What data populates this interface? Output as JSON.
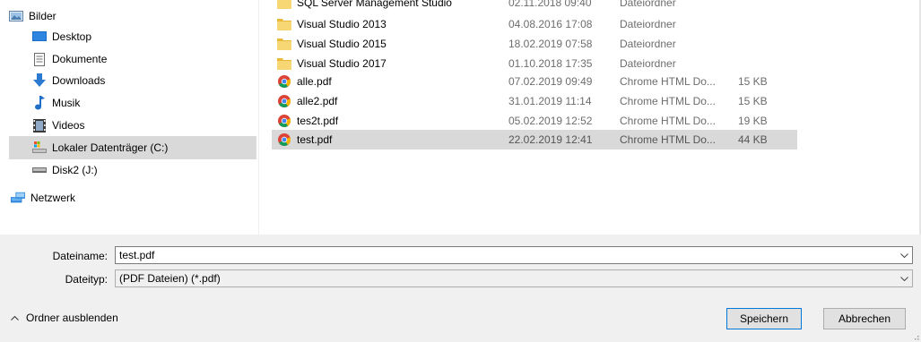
{
  "nav": {
    "items": [
      {
        "label": "Bilder",
        "icon": "pictures-icon"
      },
      {
        "label": "Desktop",
        "icon": "desktop-icon"
      },
      {
        "label": "Dokumente",
        "icon": "documents-icon"
      },
      {
        "label": "Downloads",
        "icon": "downloads-icon"
      },
      {
        "label": "Musik",
        "icon": "music-icon"
      },
      {
        "label": "Videos",
        "icon": "videos-icon"
      },
      {
        "label": "Lokaler Datenträger (C:)",
        "icon": "local-drive-icon"
      },
      {
        "label": "Disk2 (J:)",
        "icon": "drive-icon"
      },
      {
        "label": "Netzwerk",
        "icon": "network-icon"
      }
    ]
  },
  "files": {
    "rows": [
      {
        "name": "SQL Server Management Studio",
        "date": "02.11.2018 09:40",
        "type": "Dateiordner",
        "size": "",
        "icon": "folder-icon"
      },
      {
        "name": "Visual Studio 2013",
        "date": "04.08.2016 17:08",
        "type": "Dateiordner",
        "size": "",
        "icon": "folder-icon"
      },
      {
        "name": "Visual Studio 2015",
        "date": "18.02.2019 07:58",
        "type": "Dateiordner",
        "size": "",
        "icon": "folder-icon"
      },
      {
        "name": "Visual Studio 2017",
        "date": "01.10.2018 17:35",
        "type": "Dateiordner",
        "size": "",
        "icon": "folder-icon"
      },
      {
        "name": "alle.pdf",
        "date": "07.02.2019 09:49",
        "type": "Chrome HTML Do...",
        "size": "15 KB",
        "icon": "chrome-icon"
      },
      {
        "name": "alle2.pdf",
        "date": "31.01.2019 11:14",
        "type": "Chrome HTML Do...",
        "size": "15 KB",
        "icon": "chrome-icon"
      },
      {
        "name": "tes2t.pdf",
        "date": "05.02.2019 12:52",
        "type": "Chrome HTML Do...",
        "size": "19 KB",
        "icon": "chrome-icon"
      },
      {
        "name": "test.pdf",
        "date": "22.02.2019 12:41",
        "type": "Chrome HTML Do...",
        "size": "44 KB",
        "icon": "chrome-icon"
      }
    ]
  },
  "form": {
    "filename_label": "Dateiname:",
    "filename_value": "test.pdf",
    "filetype_label": "Dateityp:",
    "filetype_value": "(PDF Dateien) (*.pdf)"
  },
  "footer": {
    "hide_folders_label": "Ordner ausblenden",
    "save_label": "Speichern",
    "cancel_label": "Abbrechen"
  },
  "colors": {
    "selection": "#d9d9d9",
    "accent": "#0078d7",
    "panel": "#f0f0f0"
  }
}
